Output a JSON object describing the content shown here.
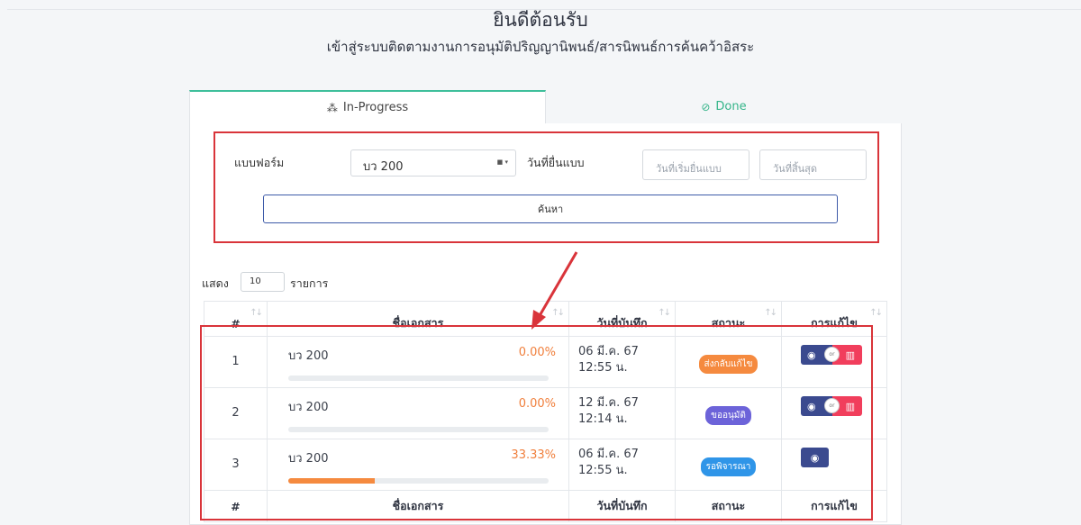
{
  "header": {
    "title": "ยินดีต้อนรับ",
    "subtitle": "เข้าสู่ระบบติดตามงานการอนุมัติปริญญานิพนธ์/สารนิพนธ์การค้นคว้าอิสระ"
  },
  "tabs": {
    "in_progress": {
      "label": "In-Progress",
      "icon": "spinner-icon"
    },
    "done": {
      "label": "Done",
      "icon": "check-circle-icon"
    }
  },
  "filter": {
    "form_label": "แบบฟอร์ม",
    "form_value": "บว 200",
    "date_label": "วันที่ยื่นแบบ",
    "start_placeholder": "วันที่เริ่มยื่นแบบ",
    "end_placeholder": "วันที่สิ้นสุด",
    "search_label": "ค้นหา"
  },
  "list_length": {
    "prefix": "แสดง",
    "value": "10",
    "suffix": "รายการ"
  },
  "table": {
    "columns": [
      "#",
      "ชื่อเอกสาร",
      "วันที่บันทึก",
      "สถานะ",
      "การแก้ไข"
    ],
    "rows": [
      {
        "index": "1",
        "doc": "บว 200",
        "percent": "0.00%",
        "progress": 0.0,
        "date": "06 มี.ค. 67",
        "time": "12:55 น.",
        "status": "ส่งกลับแก้ไข",
        "status_color": "#f58a3f",
        "actions": [
          "view",
          "delete"
        ]
      },
      {
        "index": "2",
        "doc": "บว 200",
        "percent": "0.00%",
        "progress": 0.0,
        "date": "12 มี.ค. 67",
        "time": "12:14 น.",
        "status": "ขออนุมัติ",
        "status_color": "#6c63d9",
        "actions": [
          "view",
          "delete"
        ]
      },
      {
        "index": "3",
        "doc": "บว 200",
        "percent": "33.33%",
        "progress": 0.3333,
        "date": "06 มี.ค. 67",
        "time": "12:55 น.",
        "status": "รอพิจารณา",
        "status_color": "#2f95e8",
        "actions": [
          "view"
        ]
      }
    ],
    "or_label": "or"
  },
  "colors": {
    "accent_green": "#35b58a",
    "highlight_red": "#d9343a",
    "view_button": "#3b4a8f",
    "delete_button": "#f13e5c",
    "percent_text": "#f07f3c"
  }
}
